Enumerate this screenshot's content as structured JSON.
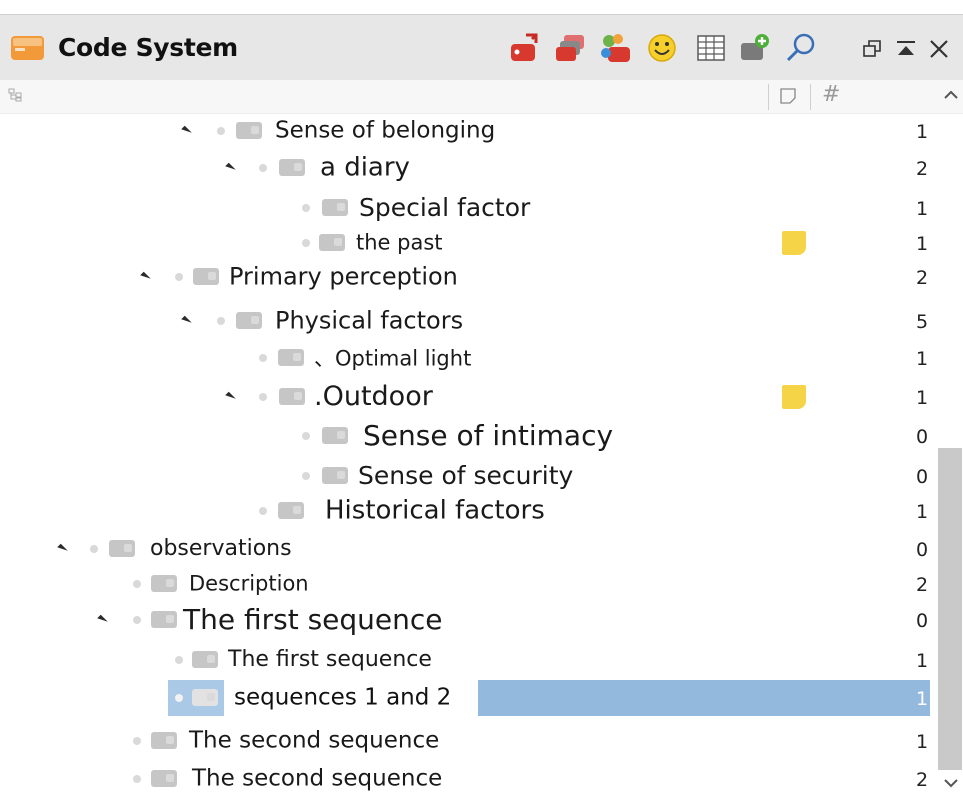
{
  "panel": {
    "title": "Code System",
    "toolbar_icons": [
      "new-code-icon",
      "code-sets-icon",
      "color-codes-icon",
      "emoticode-icon",
      "code-matrix-icon",
      "add-document-icon",
      "search-icon"
    ],
    "window_controls": [
      "undock-icon",
      "maximize-icon",
      "close-icon"
    ]
  },
  "columns": {
    "memo_icon": "memo-icon",
    "frequency": "#"
  },
  "colors": {
    "memo": "#f5d547",
    "selection": "#93b9dd",
    "titlebar": "#e7e7e7"
  },
  "rows": [
    {
      "label": "Sense of belonging",
      "count": "1",
      "expanded": true,
      "memo": false
    },
    {
      "label": "a diary",
      "count": "2",
      "expanded": true,
      "memo": false
    },
    {
      "label": "Special factor",
      "count": "1",
      "expanded": false,
      "memo": false
    },
    {
      "label": "the past",
      "count": "1",
      "expanded": false,
      "memo": true
    },
    {
      "label": "Primary perception",
      "count": "2",
      "expanded": true,
      "memo": false
    },
    {
      "label": "Physical factors",
      "count": "5",
      "expanded": true,
      "memo": false
    },
    {
      "label": "、Optimal light",
      "count": "1",
      "expanded": false,
      "memo": false
    },
    {
      "label": ".Outdoor",
      "count": "1",
      "expanded": true,
      "memo": true
    },
    {
      "label": "Sense of intimacy",
      "count": "0",
      "expanded": false,
      "memo": false
    },
    {
      "label": "Sense of security",
      "count": "0",
      "expanded": false,
      "memo": false
    },
    {
      "label": "Historical factors",
      "count": "1",
      "expanded": false,
      "memo": false
    },
    {
      "label": "observations",
      "count": "0",
      "expanded": true,
      "memo": false
    },
    {
      "label": "Description",
      "count": "2",
      "expanded": false,
      "memo": false
    },
    {
      "label": "The first sequence",
      "count": "0",
      "expanded": true,
      "memo": false
    },
    {
      "label": "The first sequence",
      "count": "1",
      "expanded": false,
      "memo": false
    },
    {
      "label": "sequences 1 and 2",
      "count": "1",
      "expanded": false,
      "memo": false,
      "selected": true
    },
    {
      "label": "The second sequence",
      "count": "1",
      "expanded": false,
      "memo": false
    },
    {
      "label": "The second sequence",
      "count": "2",
      "expanded": false,
      "memo": false
    }
  ]
}
